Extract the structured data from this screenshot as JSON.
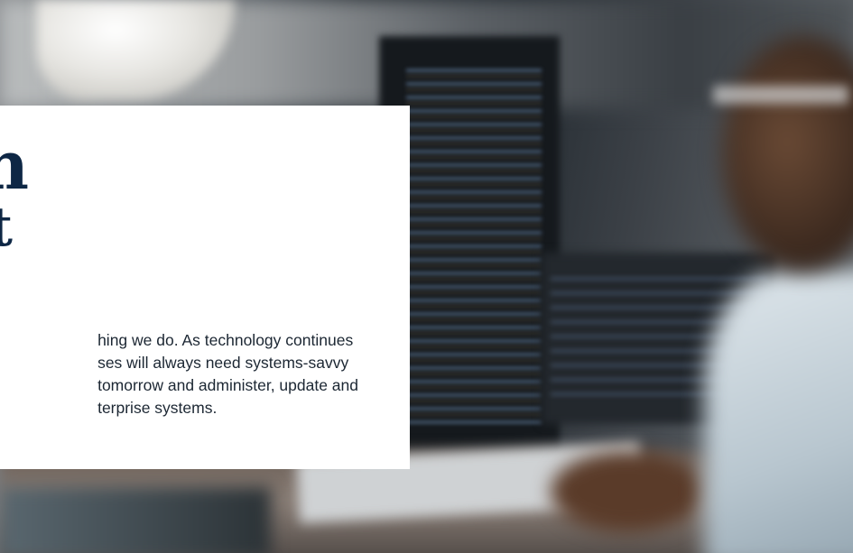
{
  "hero": {
    "heading_fragment": "n",
    "heading_fragment_line2": "t",
    "body_lines": [
      "hing we do. As technology continues",
      "ses will always need systems-savvy",
      "tomorrow and administer, update and",
      "terprise systems."
    ]
  },
  "colors": {
    "heading": "#0e2745",
    "body_text": "#1c2733",
    "card_background": "#ffffff"
  }
}
